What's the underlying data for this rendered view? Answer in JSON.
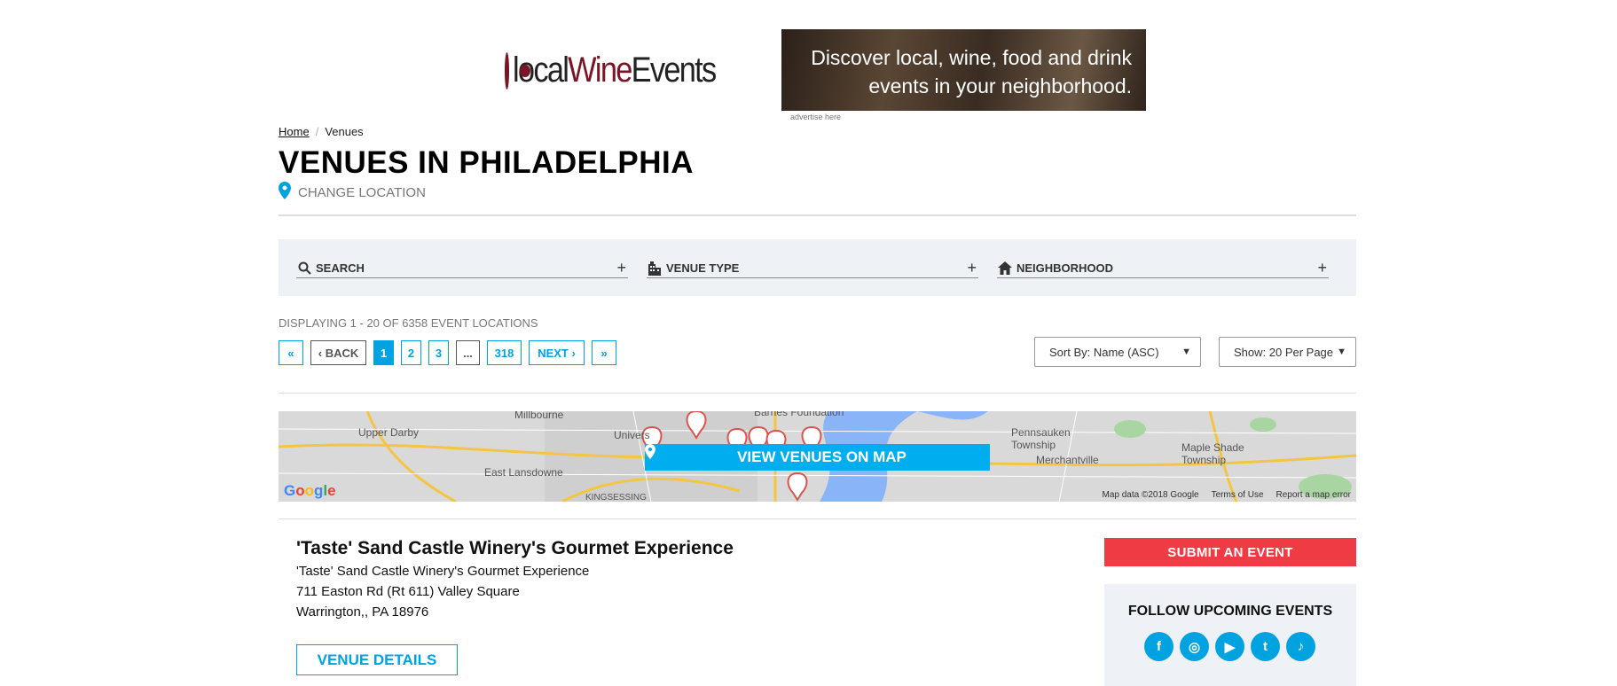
{
  "header": {
    "logo_part1": "local",
    "logo_part2": "Wine",
    "logo_part3": "Events",
    "ad_line1": "Discover local, wine, food and drink",
    "ad_line2": "events in your neighborhood.",
    "ad_caption": "advertise here"
  },
  "breadcrumb": {
    "home": "Home",
    "sep": "/",
    "current": "Venues"
  },
  "page": {
    "title": "VENUES IN PHILADELPHIA",
    "change_location": "CHANGE LOCATION"
  },
  "filters": {
    "search": "SEARCH",
    "venue_type": "VENUE TYPE",
    "neighborhood": "NEIGHBORHOOD",
    "expand": "+"
  },
  "results": {
    "display_text": "DISPLAYING 1 - 20 OF 6358 EVENT LOCATIONS"
  },
  "pagination": {
    "first": "«",
    "back": "‹ BACK",
    "pages": [
      "1",
      "2",
      "3"
    ],
    "dots": "...",
    "last_page": "318",
    "next": "NEXT ›",
    "last": "»"
  },
  "sort": {
    "selected": "Sort By: Name (ASC)"
  },
  "per_page": {
    "selected": "Show: 20 Per Page"
  },
  "map": {
    "button": "VIEW VENUES ON MAP",
    "labels": [
      "Millbourne",
      "Upper Darby",
      "Barnes Foundation",
      "University of Penn",
      "East Lansdowne",
      "Pennsauken Township",
      "Merchantville",
      "Maple Shade Township",
      "KINGSESSING"
    ],
    "google": "Google",
    "map_data": "Map data ©2018 Google",
    "terms": "Terms of Use",
    "report": "Report a map error"
  },
  "venue": {
    "name": "'Taste' Sand Castle Winery's Gourmet Experience",
    "line1": "'Taste' Sand Castle Winery's Gourmet Experience",
    "line2": "711 Easton Rd (Rt 611) Valley Square",
    "line3": "Warrington,, PA 18976",
    "details_button": "VENUE DETAILS"
  },
  "sidebar": {
    "submit": "SUBMIT AN EVENT",
    "follow_title": "FOLLOW UPCOMING EVENTS",
    "socials": [
      {
        "icon": "facebook-icon",
        "glyph": "f"
      },
      {
        "icon": "instagram-icon",
        "glyph": "◎"
      },
      {
        "icon": "youtube-icon",
        "glyph": "▶"
      },
      {
        "icon": "twitter-icon",
        "glyph": "t"
      },
      {
        "icon": "tiktok-icon",
        "glyph": "♪"
      }
    ]
  },
  "colors": {
    "accent": "#00a3e0",
    "brand": "#7a1526",
    "submit": "#ef3b43",
    "panel": "#eef2f6"
  }
}
